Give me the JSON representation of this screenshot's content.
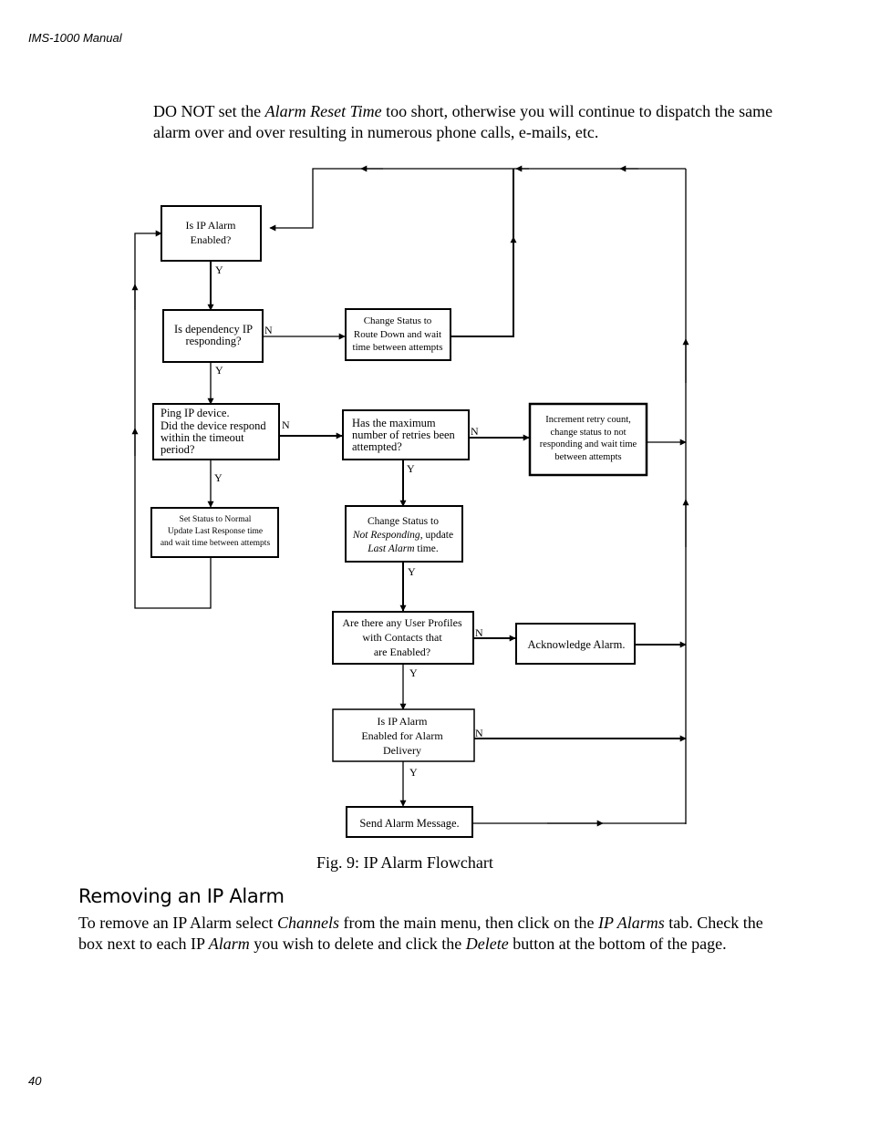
{
  "page_header": "IMS-1000  Manual",
  "intro_paragraph": {
    "parts": [
      {
        "text": "DO NOT set the ",
        "italic": false
      },
      {
        "text": "Alarm Reset Time",
        "italic": true
      },
      {
        "text": " too short, otherwise you will continue to dispatch the same alarm over and over resulting in numerous phone calls, e-mails, etc.",
        "italic": false
      }
    ]
  },
  "flowchart": {
    "nodes": {
      "ip_alarm_enabled": [
        "Is IP Alarm",
        "Enabled?"
      ],
      "dependency_ip": [
        "Is dependency IP",
        "responding?"
      ],
      "route_down": [
        "Change Status to",
        "Route Down and wait",
        "time between attempts"
      ],
      "ping_device": [
        "Ping IP device.",
        "Did the device respond",
        "within the timeout",
        "period?"
      ],
      "max_retries": [
        "Has the maximum",
        "number of retries been",
        "attempted?"
      ],
      "increment_retry": [
        "Increment retry count,",
        "change status to not",
        "responding and wait time",
        "between attempts"
      ],
      "set_normal": [
        "Set Status to Normal",
        "Update Last Response time",
        "and wait time between attempts"
      ],
      "not_responding": {
        "line1": "Change Status to",
        "line2_italic": "Not Responding",
        "line2_rest": ", update",
        "line3_italic": "Last Alarm",
        "line3_rest": " time."
      },
      "user_profiles": [
        "Are there any User Profiles",
        "with Contacts that",
        "are Enabled?"
      ],
      "acknowledge": [
        "Acknowledge Alarm."
      ],
      "alarm_delivery": [
        "Is IP Alarm",
        "Enabled for Alarm",
        "Delivery"
      ],
      "send_alarm": [
        "Send Alarm Message."
      ]
    },
    "labels": {
      "yes": "Y",
      "no": "N"
    }
  },
  "figure_caption": "Fig. 9: IP Alarm Flowchart",
  "section": {
    "title": "Removing an IP Alarm",
    "paragraph": [
      {
        "text": "To remove an IP Alarm select ",
        "italic": false
      },
      {
        "text": "Channels",
        "italic": true
      },
      {
        "text": " from the main menu, then click on the ",
        "italic": false
      },
      {
        "text": "IP Alarms",
        "italic": true
      },
      {
        "text": " tab. Check the box next to each IP ",
        "italic": false
      },
      {
        "text": "Alarm",
        "italic": true
      },
      {
        "text": " you wish to delete and click the ",
        "italic": false
      },
      {
        "text": "Delete",
        "italic": true
      },
      {
        "text": " button at the bottom of the page.",
        "italic": false
      }
    ]
  },
  "page_number": "40"
}
